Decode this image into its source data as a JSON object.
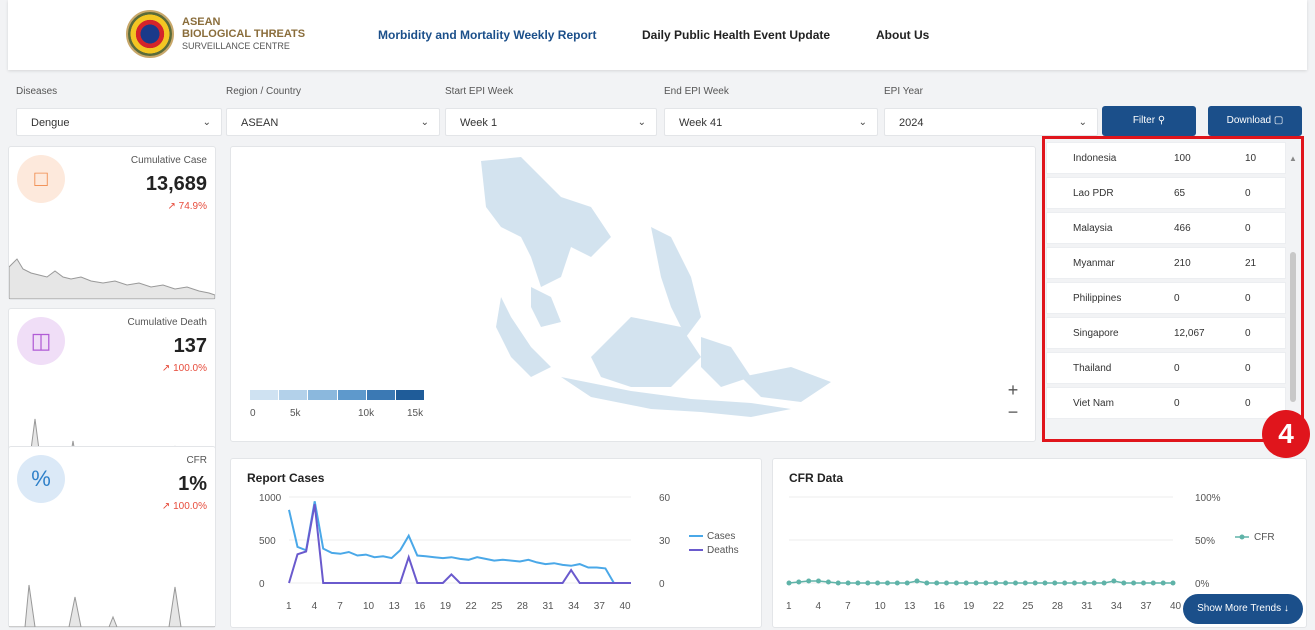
{
  "header": {
    "logo_line1": "ASEAN",
    "logo_line2": "BIOLOGICAL THREATS",
    "logo_line3": "SURVEILLANCE CENTRE",
    "nav": [
      "Morbidity and Mortality Weekly Report",
      "Daily Public Health Event Update",
      "About Us"
    ]
  },
  "filters": {
    "diseases": {
      "label": "Diseases",
      "value": "Dengue"
    },
    "region": {
      "label": "Region / Country",
      "value": "ASEAN"
    },
    "start_week": {
      "label": "Start EPI Week",
      "value": "Week 1"
    },
    "end_week": {
      "label": "End EPI Week",
      "value": "Week 41"
    },
    "year": {
      "label": "EPI Year",
      "value": "2024"
    },
    "filter_btn": "Filter",
    "download_btn": "Download"
  },
  "kpis": [
    {
      "label": "Cumulative Case",
      "value": "13,689",
      "trend": "↗ 74.9%",
      "icon": "message-icon",
      "color": "#f0a070"
    },
    {
      "label": "Cumulative Death",
      "value": "137",
      "trend": "↗ 100.0%",
      "icon": "briefcase-icon",
      "color": "#b05cd6"
    },
    {
      "label": "CFR",
      "value": "1%",
      "trend": "↗ 100.0%",
      "icon": "percent-icon",
      "color": "#2f80c9"
    }
  ],
  "map_legend": {
    "ticks": [
      "0",
      "5k",
      "10k",
      "15k"
    ]
  },
  "country_table": [
    {
      "country": "Indonesia",
      "cases": "100",
      "deaths": "10"
    },
    {
      "country": "Lao PDR",
      "cases": "65",
      "deaths": "0"
    },
    {
      "country": "Malaysia",
      "cases": "466",
      "deaths": "0"
    },
    {
      "country": "Myanmar",
      "cases": "210",
      "deaths": "21"
    },
    {
      "country": "Philippines",
      "cases": "0",
      "deaths": "0"
    },
    {
      "country": "Singapore",
      "cases": "12,067",
      "deaths": "0"
    },
    {
      "country": "Thailand",
      "cases": "0",
      "deaths": "0"
    },
    {
      "country": "Viet Nam",
      "cases": "0",
      "deaths": "0"
    }
  ],
  "annotation_badge": "4",
  "report_cases": {
    "title": "Report Cases",
    "left_ticks": [
      "1000",
      "500",
      "0"
    ],
    "right_ticks": [
      "60",
      "30",
      "0"
    ],
    "x_ticks": [
      "1",
      "4",
      "7",
      "10",
      "13",
      "16",
      "19",
      "22",
      "25",
      "28",
      "31",
      "34",
      "37",
      "40"
    ],
    "legend": [
      "Cases",
      "Deaths"
    ],
    "cases": [
      850,
      420,
      380,
      950,
      400,
      350,
      340,
      360,
      320,
      330,
      300,
      310,
      290,
      380,
      550,
      320,
      310,
      300,
      290,
      300,
      280,
      270,
      300,
      280,
      260,
      270,
      260,
      250,
      270,
      240,
      220,
      230,
      210,
      200,
      220,
      180,
      180,
      170,
      0,
      0,
      0
    ],
    "deaths": [
      0,
      20,
      22,
      55,
      0,
      0,
      0,
      0,
      0,
      0,
      0,
      0,
      0,
      0,
      18,
      0,
      0,
      0,
      0,
      6,
      0,
      0,
      0,
      0,
      0,
      0,
      0,
      0,
      0,
      0,
      0,
      0,
      0,
      9,
      0,
      0,
      0,
      0,
      0,
      0,
      0
    ]
  },
  "cfr_data": {
    "title": "CFR Data",
    "right_ticks": [
      "100%",
      "50%",
      "0%"
    ],
    "x_ticks": [
      "1",
      "4",
      "7",
      "10",
      "13",
      "16",
      "19",
      "22",
      "25",
      "28",
      "31",
      "34",
      "37",
      "40"
    ],
    "legend": "CFR"
  },
  "show_more": "Show More Trends",
  "colors": {
    "primary": "#1b4f8a",
    "cases_line": "#4aa8e8",
    "deaths_line": "#6a5acd",
    "cfr": "#5fb3a8",
    "highlight": "#e0151c"
  }
}
